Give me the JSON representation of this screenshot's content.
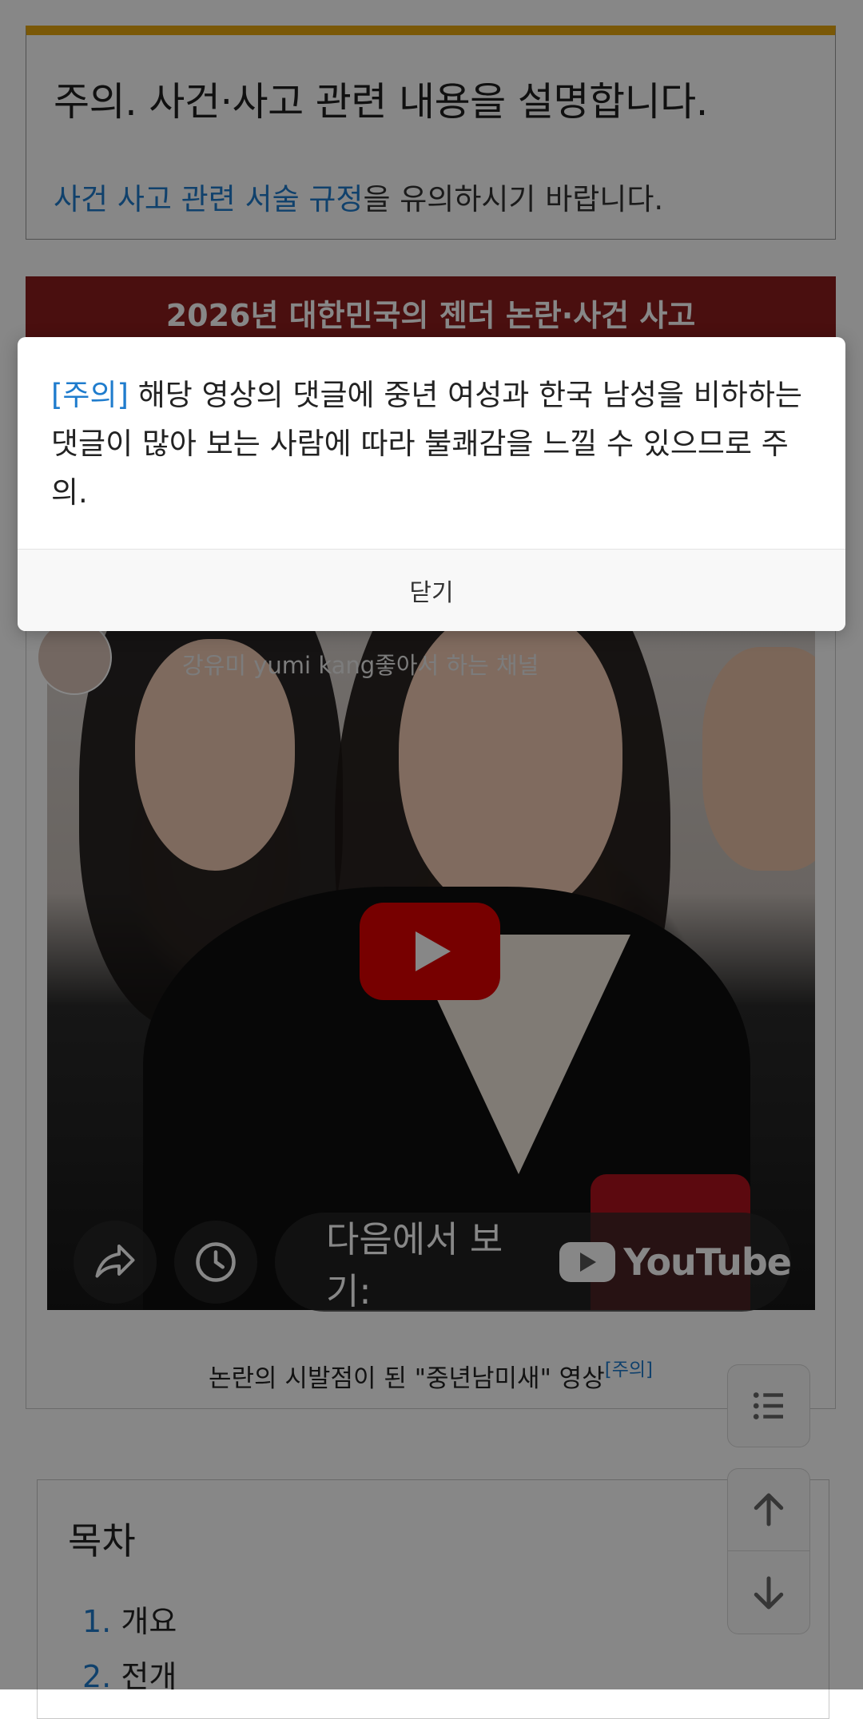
{
  "notice": {
    "title": "주의. 사건·사고 관련 내용을 설명합니다.",
    "rule_link": "사건 사고 관련 서술 규정",
    "rule_suffix": "을 유의하시기 바랍니다."
  },
  "infobox": {
    "header": "2026년 대한민국의 젠더 논란·사건 사고"
  },
  "video": {
    "channel_sub": "강유미 yumi kang좋아서 하는 채널",
    "watch_on_label": "다음에서 보기:",
    "platform": "YouTube",
    "caption": "논란의 시발점이 된 \"중년남미새\" 영상",
    "caption_note": "[주의]"
  },
  "toc": {
    "title": "목차",
    "items": [
      {
        "num": "1.",
        "label": "개요"
      },
      {
        "num": "2.",
        "label": "전개"
      }
    ]
  },
  "dialog": {
    "tag": "[주의]",
    "message": " 해당 영상의 댓글에 중년 여성과 한국 남성을 비하하는 댓글이 많아 보는 사람에 따라 불쾌감을 느낄 수 있으므로 주의.",
    "close_label": "닫기"
  },
  "colors": {
    "accent_link": "#1f7ccd",
    "notice_border": "#e6a70f",
    "infobox_header": "#8c1e1e",
    "youtube_red": "#e10000"
  },
  "icons": [
    "share-icon",
    "clock-icon",
    "play-icon",
    "youtube-logo-icon",
    "list-icon",
    "arrow-up-icon",
    "arrow-down-icon"
  ]
}
